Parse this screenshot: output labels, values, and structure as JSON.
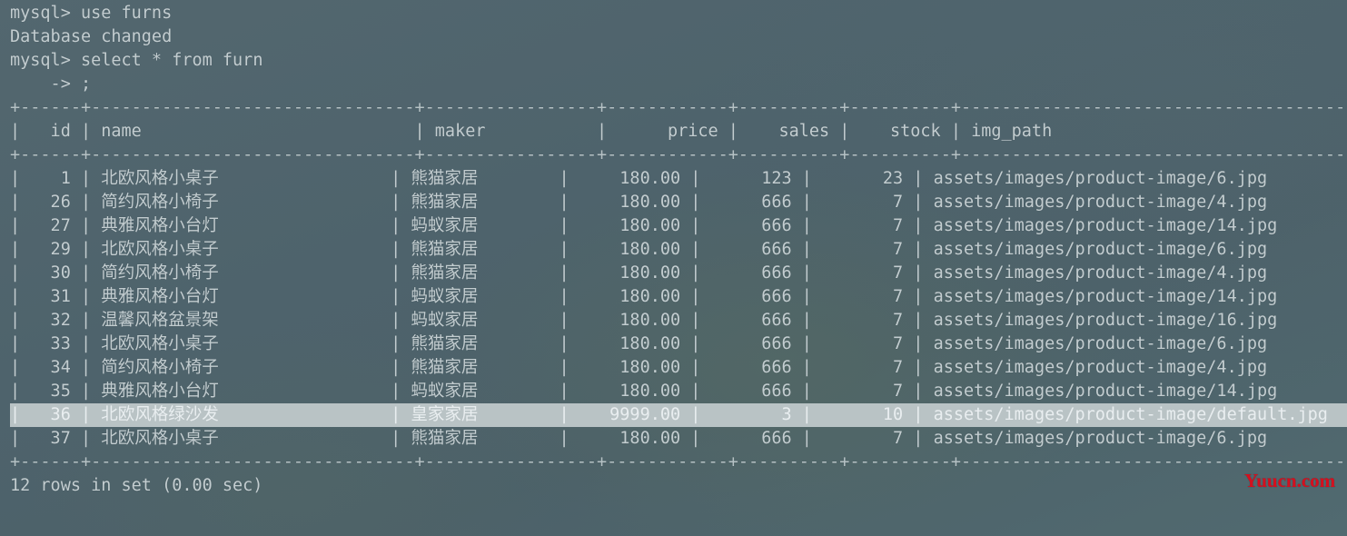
{
  "terminal": {
    "theme": {
      "background": "#4f646d",
      "foreground": "#c3cdd0",
      "selection_background": "#b9c3c5",
      "selection_foreground": "#e9eef0",
      "watermark_color": "#d50f1e"
    },
    "prompt": "mysql>",
    "continuation_prompt": "    ->",
    "history": [
      {
        "type": "command",
        "prompt": "mysql>",
        "text": "use furns"
      },
      {
        "type": "output",
        "text": "Database changed"
      },
      {
        "type": "command",
        "prompt": "mysql>",
        "text": "select * from furn"
      },
      {
        "type": "continuation",
        "prompt": "    ->",
        "text": ";"
      }
    ],
    "status_line": "12 rows in set (0.00 sec)",
    "watermark": "Yuucn.com"
  },
  "result_table": {
    "columns": [
      {
        "name": "id",
        "width": 4,
        "align": "right"
      },
      {
        "name": "name",
        "width": 30,
        "align": "left"
      },
      {
        "name": "maker",
        "width": 15,
        "align": "left"
      },
      {
        "name": "price",
        "width": 10,
        "align": "right"
      },
      {
        "name": "sales",
        "width": 8,
        "align": "right"
      },
      {
        "name": "stock",
        "width": 8,
        "align": "right"
      },
      {
        "name": "img_path",
        "width": 49,
        "align": "left"
      }
    ],
    "row_count": 12,
    "selected_row_index": 10,
    "rows": [
      {
        "id": "1",
        "name": "北欧风格小桌子",
        "maker": "熊猫家居",
        "price": "180.00",
        "sales": "123",
        "stock": "23",
        "img_path": "assets/images/product-image/6.jpg"
      },
      {
        "id": "26",
        "name": "简约风格小椅子",
        "maker": "熊猫家居",
        "price": "180.00",
        "sales": "666",
        "stock": "7",
        "img_path": "assets/images/product-image/4.jpg"
      },
      {
        "id": "27",
        "name": "典雅风格小台灯",
        "maker": "蚂蚁家居",
        "price": "180.00",
        "sales": "666",
        "stock": "7",
        "img_path": "assets/images/product-image/14.jpg"
      },
      {
        "id": "29",
        "name": "北欧风格小桌子",
        "maker": "熊猫家居",
        "price": "180.00",
        "sales": "666",
        "stock": "7",
        "img_path": "assets/images/product-image/6.jpg"
      },
      {
        "id": "30",
        "name": "简约风格小椅子",
        "maker": "熊猫家居",
        "price": "180.00",
        "sales": "666",
        "stock": "7",
        "img_path": "assets/images/product-image/4.jpg"
      },
      {
        "id": "31",
        "name": "典雅风格小台灯",
        "maker": "蚂蚁家居",
        "price": "180.00",
        "sales": "666",
        "stock": "7",
        "img_path": "assets/images/product-image/14.jpg"
      },
      {
        "id": "32",
        "name": "温馨风格盆景架",
        "maker": "蚂蚁家居",
        "price": "180.00",
        "sales": "666",
        "stock": "7",
        "img_path": "assets/images/product-image/16.jpg"
      },
      {
        "id": "33",
        "name": "北欧风格小桌子",
        "maker": "熊猫家居",
        "price": "180.00",
        "sales": "666",
        "stock": "7",
        "img_path": "assets/images/product-image/6.jpg"
      },
      {
        "id": "34",
        "name": "简约风格小椅子",
        "maker": "熊猫家居",
        "price": "180.00",
        "sales": "666",
        "stock": "7",
        "img_path": "assets/images/product-image/4.jpg"
      },
      {
        "id": "35",
        "name": "典雅风格小台灯",
        "maker": "蚂蚁家居",
        "price": "180.00",
        "sales": "666",
        "stock": "7",
        "img_path": "assets/images/product-image/14.jpg"
      },
      {
        "id": "36",
        "name": "北欧风格绿沙发",
        "maker": "皇家家居",
        "price": "9999.00",
        "sales": "3",
        "stock": "10",
        "img_path": "assets/images/product-image/default.jpg"
      },
      {
        "id": "37",
        "name": "北欧风格小桌子",
        "maker": "熊猫家居",
        "price": "180.00",
        "sales": "666",
        "stock": "7",
        "img_path": "assets/images/product-image/6.jpg"
      }
    ]
  }
}
